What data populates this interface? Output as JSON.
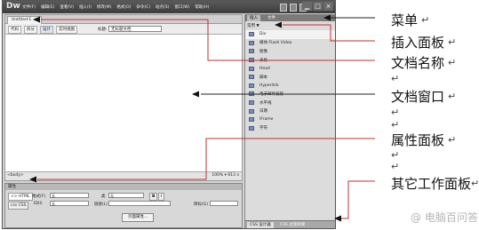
{
  "app": {
    "logo": "Dw",
    "menus": [
      "文件(F)",
      "编辑(E)",
      "查看(V)",
      "插入(I)",
      "修改(M)",
      "格式(O)",
      "命令(C)",
      "站点(S)",
      "窗口(W)",
      "帮助(H)"
    ],
    "window_buttons": [
      "▁",
      "□",
      "×"
    ]
  },
  "document": {
    "tab_label": "Untitled-1",
    "tab_close": "×",
    "view_buttons": [
      "代码",
      "拆分",
      "设计",
      "实时视图"
    ],
    "title_label": "标题:",
    "title_value": "无标题文档",
    "tag_selector": "<body>",
    "status_right": "100% ▾ 613 x"
  },
  "properties": {
    "title": "属性",
    "html_button": "<> HTML",
    "css_button": "css CSS",
    "format_label": "格式(F)",
    "format_value": "无",
    "class_label": "类",
    "class_value": "无",
    "id_label": "ID(I)",
    "id_value": "无",
    "link_label": "链接(L)",
    "target_label": "目标(G)",
    "bold": "B",
    "italic": "I",
    "page_props_button": "页面属性..."
  },
  "insert_panel": {
    "tabs": [
      "插入",
      "文件"
    ],
    "category": "常用 ▼",
    "items": [
      "Div",
      "媒体:Flash Video",
      "图像",
      "表格",
      "Head",
      "脚本",
      "Hyperlink",
      "电子邮件链接",
      "水平线",
      "日期",
      "IFrame",
      "字符"
    ],
    "bottom_tabs": [
      "CSS 设计器",
      "CSS 过渡效果"
    ]
  },
  "annotations": [
    {
      "label": "菜单"
    },
    {
      "label": "插入面板"
    },
    {
      "label": "文档名称"
    },
    {
      "label": "文档窗口"
    },
    {
      "label": "属性面板"
    },
    {
      "label": "其它工作面板"
    }
  ],
  "annotation_return_mark": "↵",
  "watermark": "@ 电脑百问答"
}
